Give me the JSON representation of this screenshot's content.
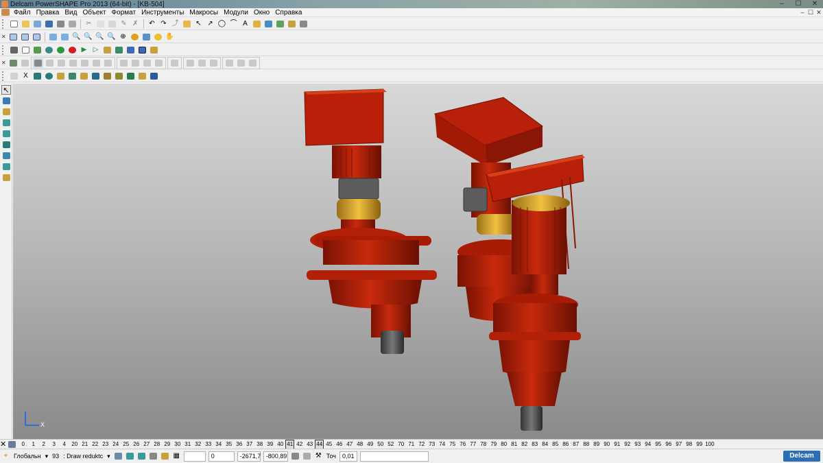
{
  "window": {
    "title": "Delcam PowerSHAPE Pro 2013 (64-bit) - [KB-504]",
    "min": "‒",
    "max": "☐",
    "close": "✕"
  },
  "menu": [
    "Файл",
    "Правка",
    "Вид",
    "Объект",
    "Формат",
    "Инструменты",
    "Макросы",
    "Модули",
    "Окно",
    "Справка"
  ],
  "levels": {
    "items": [
      "0",
      "1",
      "2",
      "3",
      "4",
      "20",
      "21",
      "22",
      "23",
      "24",
      "25",
      "26",
      "27",
      "28",
      "29",
      "30",
      "31",
      "32",
      "33",
      "34",
      "35",
      "36",
      "37",
      "38",
      "39",
      "40",
      "41",
      "42",
      "43",
      "44",
      "45",
      "46",
      "47",
      "48",
      "49",
      "50",
      "52",
      "70",
      "71",
      "72",
      "73",
      "74",
      "75",
      "76",
      "77",
      "78",
      "79",
      "80",
      "81",
      "82",
      "83",
      "84",
      "85",
      "86",
      "87",
      "88",
      "89",
      "90",
      "91",
      "92",
      "93",
      "94",
      "95",
      "96",
      "97",
      "98",
      "99",
      "100"
    ],
    "active": [
      "41",
      "44"
    ]
  },
  "status": {
    "workplane": "Глобальн",
    "level_num": "93",
    "level_name": ": Draw reduktc",
    "field_a": "0",
    "x": "-2671,7",
    "y": "-800,89",
    "tol_label": "Точ",
    "tol_value": "0,01",
    "logo": "Delcam"
  },
  "axis": {
    "x_label": "X"
  },
  "colors": {
    "accent": "#2a6fb5",
    "model_red": "#b51b07",
    "model_dark": "#7a1204",
    "motor_yellow": "#d9a832",
    "brake_grey": "#6b6b6b"
  }
}
